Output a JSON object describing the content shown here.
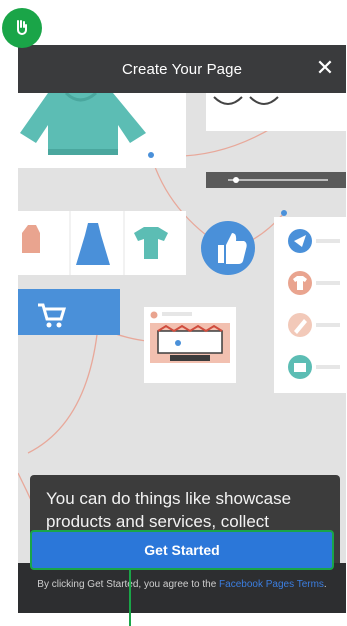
{
  "header": {
    "title": "Create Your Page",
    "close_icon": "close-icon"
  },
  "illustration": {
    "icons": [
      "sweater-icon",
      "glasses-icon",
      "tank-top-icon",
      "dress-icon",
      "tshirt-icon",
      "like-thumb-icon",
      "shopping-cart-icon",
      "send-icon",
      "shirt-icon",
      "pencil-icon",
      "bag-icon"
    ],
    "accent_colors": {
      "teal": "#5cbdb4",
      "blue": "#4a90d9",
      "salmon": "#e9a48f",
      "line": "#e8a89a"
    }
  },
  "caption": {
    "text": "You can do things like showcase products and services, collect donations and create ads."
  },
  "cta": {
    "label": "Get Started",
    "color": "#2b77d9"
  },
  "terms": {
    "prefix": "By clicking Get Started, you agree to the ",
    "link": "Facebook Pages Terms",
    "suffix": "."
  },
  "annotation": {
    "badge_color": "#1aa548"
  }
}
